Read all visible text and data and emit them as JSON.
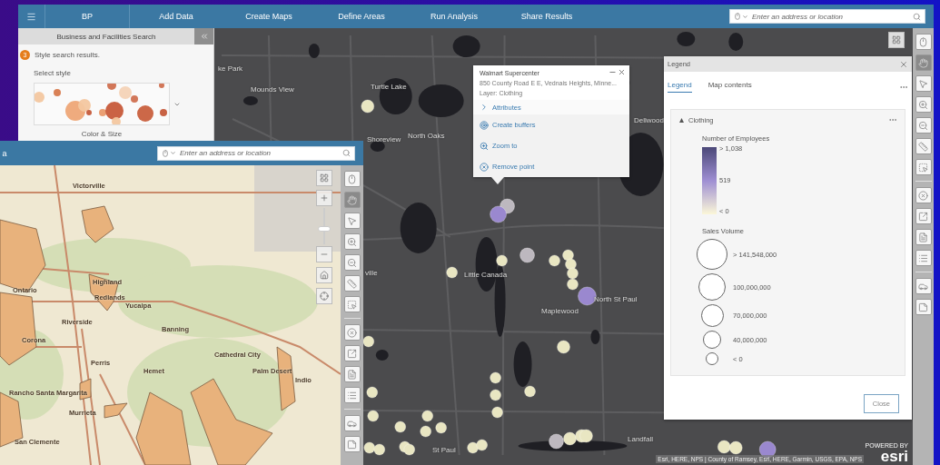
{
  "back_window": {
    "nav": {
      "project": "BP",
      "items": [
        "Add Data",
        "Create Maps",
        "Define Areas",
        "Run Analysis",
        "Share Results"
      ],
      "search": {
        "placeholder": "Enter an address or location"
      }
    },
    "side_panel": {
      "title": "Business and Facilities Search",
      "step": {
        "number": "3",
        "text": "Style search results."
      },
      "style_label": "Select style",
      "style_name": "Color & Size"
    },
    "map": {
      "labels": [
        "ke Park",
        "Mounds View",
        "Turtle Lake",
        "Shoreview",
        "North Oaks",
        "Dellwood",
        "ville",
        "Little Canada",
        "Maplewood",
        "North St Paul",
        "Landfall",
        "St Paul"
      ],
      "attribution": "Esri, HERE, NPS | County of Ramsey, Esri, HERE, Garmin, USGS, EPA, NPS",
      "logo": {
        "caption": "POWERED BY",
        "name": "esri"
      }
    },
    "popup": {
      "title": "Walmart Supercenter",
      "address": "850 County Road E E, Vednais Heights, Minne...",
      "layer": "Layer: Clothing",
      "actions": [
        {
          "kind": "attributes",
          "label": "Attributes"
        },
        {
          "kind": "buffers",
          "label": "Create buffers"
        },
        {
          "kind": "zoom",
          "label": "Zoom to"
        },
        {
          "kind": "remove",
          "label": "Remove point"
        }
      ]
    },
    "legend": {
      "title": "Legend",
      "tabs": [
        {
          "label": "Legend",
          "selected": true
        },
        {
          "label": "Map contents",
          "selected": false
        }
      ],
      "layer": {
        "name": "Clothing",
        "expanded": true,
        "color_title": "Number of Employees",
        "color_stops": [
          "> 1,038",
          "519",
          "< 0"
        ],
        "size_title": "Sales Volume",
        "size_stops": [
          "> 141,548,000",
          "100,000,000",
          "70,000,000",
          "40,000,000",
          "< 0"
        ]
      },
      "close_button": "Close"
    },
    "toolbar": {
      "groups": [
        [
          {
            "kind": "mouse",
            "selected": false
          },
          {
            "kind": "hand",
            "selected": true
          },
          {
            "kind": "pointer",
            "selected": false
          },
          {
            "kind": "zoom-in",
            "selected": false
          },
          {
            "kind": "zoom-out",
            "selected": false
          },
          {
            "kind": "measure",
            "selected": false
          },
          {
            "kind": "select",
            "selected": false
          }
        ],
        [
          {
            "kind": "clear",
            "selected": false
          },
          {
            "kind": "share",
            "selected": false
          },
          {
            "kind": "document",
            "selected": false
          },
          {
            "kind": "list",
            "selected": false
          }
        ],
        [
          {
            "kind": "car",
            "selected": false
          },
          {
            "kind": "note",
            "selected": false
          }
        ]
      ]
    }
  },
  "front_window": {
    "title": "a",
    "search": {
      "placeholder": "Enter an address or location"
    },
    "map": {
      "labels": [
        "Victorville",
        "Highland",
        "Redlands",
        "Yucaipa",
        "Ontario",
        "Riverside",
        "Banning",
        "Corona",
        "Perris",
        "Hemet",
        "Cathedral City",
        "Palm Desert",
        "Indio",
        "Rancho Santa Margarita",
        "Murrieta",
        "San Clemente"
      ],
      "zoom_slider": {
        "level": 0.4
      }
    },
    "toolbar": {
      "groups": [
        [
          {
            "kind": "mouse",
            "selected": false
          },
          {
            "kind": "hand",
            "selected": true
          },
          {
            "kind": "pointer",
            "selected": false
          },
          {
            "kind": "zoom-in",
            "selected": false
          },
          {
            "kind": "zoom-out",
            "selected": false
          },
          {
            "kind": "measure",
            "selected": false
          },
          {
            "kind": "select",
            "selected": false
          }
        ],
        [
          {
            "kind": "clear",
            "selected": false
          },
          {
            "kind": "share",
            "selected": false
          },
          {
            "kind": "document",
            "selected": false
          },
          {
            "kind": "list",
            "selected": false
          }
        ],
        [
          {
            "kind": "car",
            "selected": false
          },
          {
            "kind": "note",
            "selected": false
          }
        ]
      ]
    }
  }
}
